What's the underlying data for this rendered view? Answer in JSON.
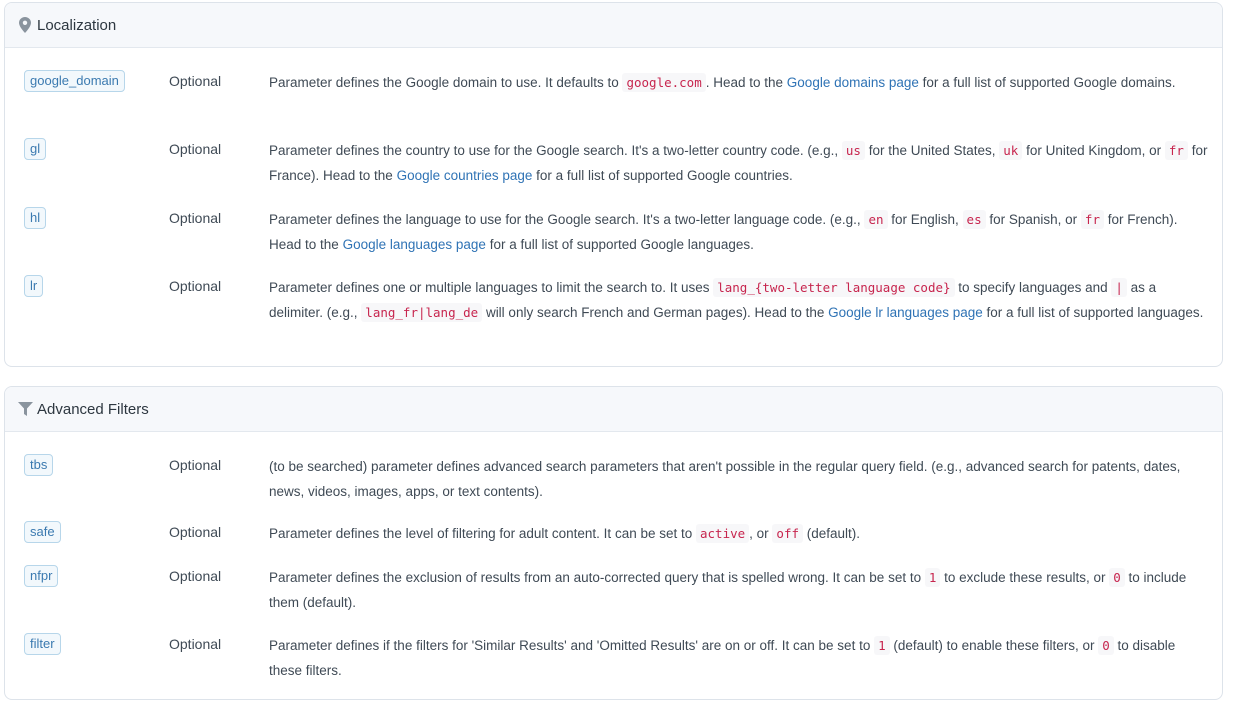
{
  "localization": {
    "title": "Localization",
    "icon": "location-pin-icon",
    "params": [
      {
        "name": "google_domain",
        "required": "Optional",
        "desc": [
          {
            "t": "Parameter defines the Google domain to use. It defaults to "
          },
          {
            "t": "google.com",
            "k": "code"
          },
          {
            "t": ". Head to the "
          },
          {
            "t": "Google domains page",
            "k": "link"
          },
          {
            "t": " for a full list of supported Google domains."
          }
        ]
      },
      {
        "name": "gl",
        "required": "Optional",
        "desc": [
          {
            "t": "Parameter defines the country to use for the Google search. It's a two-letter country code. (e.g., "
          },
          {
            "t": "us",
            "k": "code"
          },
          {
            "t": " for the United States, "
          },
          {
            "t": "uk",
            "k": "code"
          },
          {
            "t": " for United Kingdom, or "
          },
          {
            "t": "fr",
            "k": "code"
          },
          {
            "t": " for France). Head to the "
          },
          {
            "t": "Google countries page",
            "k": "link"
          },
          {
            "t": " for a full list of supported Google countries."
          }
        ]
      },
      {
        "name": "hl",
        "required": "Optional",
        "desc": [
          {
            "t": "Parameter defines the language to use for the Google search. It's a two-letter language code. (e.g., "
          },
          {
            "t": "en",
            "k": "code"
          },
          {
            "t": " for English, "
          },
          {
            "t": "es",
            "k": "code"
          },
          {
            "t": " for Spanish, or "
          },
          {
            "t": "fr",
            "k": "code"
          },
          {
            "t": " for French). Head to the "
          },
          {
            "t": "Google languages page",
            "k": "link"
          },
          {
            "t": " for a full list of supported Google languages."
          }
        ]
      },
      {
        "name": "lr",
        "required": "Optional",
        "desc": [
          {
            "t": "Parameter defines one or multiple languages to limit the search to. It uses "
          },
          {
            "t": "lang_{two-letter language code}",
            "k": "code"
          },
          {
            "t": " to specify languages and "
          },
          {
            "t": "|",
            "k": "code"
          },
          {
            "t": " as a delimiter. (e.g., "
          },
          {
            "t": "lang_fr|lang_de",
            "k": "code"
          },
          {
            "t": " will only search French and German pages). Head to the "
          },
          {
            "t": "Google lr languages page",
            "k": "link"
          },
          {
            "t": " for a full list of supported languages."
          }
        ]
      }
    ]
  },
  "advanced_filters": {
    "title": "Advanced Filters",
    "icon": "filter-funnel-icon",
    "params": [
      {
        "name": "tbs",
        "required": "Optional",
        "desc": [
          {
            "t": "(to be searched) parameter defines advanced search parameters that aren't possible in the regular query field. (e.g., advanced search for patents, dates, news, videos, images, apps, or text contents)."
          }
        ]
      },
      {
        "name": "safe",
        "required": "Optional",
        "desc": [
          {
            "t": "Parameter defines the level of filtering for adult content. It can be set to "
          },
          {
            "t": "active",
            "k": "code"
          },
          {
            "t": ", or "
          },
          {
            "t": "off",
            "k": "code"
          },
          {
            "t": " (default)."
          }
        ]
      },
      {
        "name": "nfpr",
        "required": "Optional",
        "desc": [
          {
            "t": "Parameter defines the exclusion of results from an auto-corrected query that is spelled wrong. It can be set to "
          },
          {
            "t": "1",
            "k": "code"
          },
          {
            "t": " to exclude these results, or "
          },
          {
            "t": "0",
            "k": "code"
          },
          {
            "t": " to include them (default)."
          }
        ]
      },
      {
        "name": "filter",
        "required": "Optional",
        "desc": [
          {
            "t": "Parameter defines if the filters for 'Similar Results' and 'Omitted Results' are on or off. It can be set to "
          },
          {
            "t": "1",
            "k": "code"
          },
          {
            "t": " (default) to enable these filters, or "
          },
          {
            "t": "0",
            "k": "code"
          },
          {
            "t": " to disable these filters."
          }
        ]
      }
    ]
  }
}
